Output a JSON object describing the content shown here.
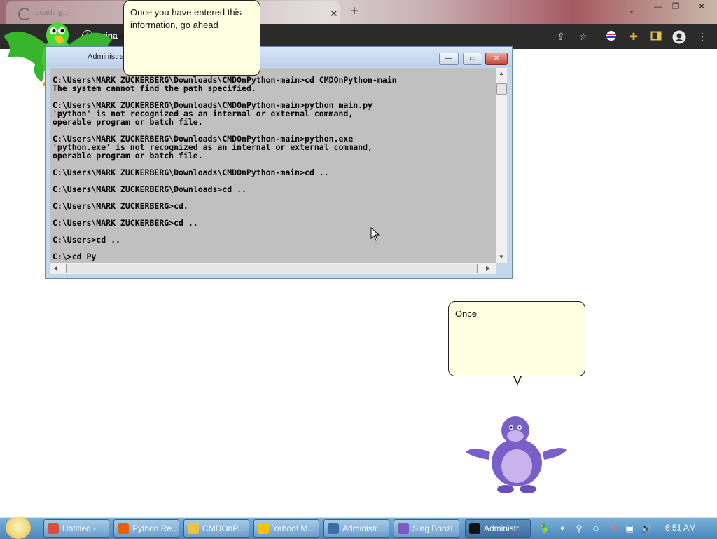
{
  "browser": {
    "tab_title": "Loading...",
    "tab_close": "✕",
    "new_tab": "+",
    "tab_menu": "⌄",
    "window_buttons": [
      "—",
      "❐",
      "✕"
    ],
    "address_text": "wina"
  },
  "console": {
    "title": "Administrator: C",
    "lines": [
      "C:\\Users\\MARK ZUCKERBERG\\Downloads\\CMDOnPython-main>cd CMDOnPython-main",
      "The system cannot find the path specified.",
      "",
      "C:\\Users\\MARK ZUCKERBERG\\Downloads\\CMDOnPython-main>python main.py",
      "'python' is not recognized as an internal or external command,",
      "operable program or batch file.",
      "",
      "C:\\Users\\MARK ZUCKERBERG\\Downloads\\CMDOnPython-main>python.exe",
      "'python.exe' is not recognized as an internal or external command,",
      "operable program or batch file.",
      "",
      "C:\\Users\\MARK ZUCKERBERG\\Downloads\\CMDOnPython-main>cd ..",
      "",
      "C:\\Users\\MARK ZUCKERBERG\\Downloads>cd ..",
      "",
      "C:\\Users\\MARK ZUCKERBERG>cd.",
      "",
      "C:\\Users\\MARK ZUCKERBERG>cd ..",
      "",
      "C:\\Users>cd ..",
      "",
      "C:\\>cd Py"
    ],
    "btn_minimize": "—",
    "btn_maximize": "▭",
    "btn_close": "✕"
  },
  "bubbles": {
    "parrot_text": "Once you have entered this information, go ahead",
    "bonzi_text": "Once"
  },
  "taskbar": {
    "buttons": [
      {
        "label": "Untitled - ...",
        "icon": "chrome-icon",
        "color": "#d94f3d"
      },
      {
        "label": "Python Re...",
        "icon": "firefox-icon",
        "color": "#e66000"
      },
      {
        "label": "CMDOnP...",
        "icon": "folder-icon",
        "color": "#e8c34a"
      },
      {
        "label": "Yahoo! M...",
        "icon": "yahoo-messenger-icon",
        "color": "#f5c400"
      },
      {
        "label": "Administr...",
        "icon": "window-icon",
        "color": "#3a6ea5"
      },
      {
        "label": "Sing Bonzi...",
        "icon": "bonzi-icon",
        "color": "#7a5cc2"
      },
      {
        "label": "Administr...",
        "icon": "cmd-icon",
        "color": "#111111"
      }
    ],
    "clock": "6:51 AM"
  }
}
